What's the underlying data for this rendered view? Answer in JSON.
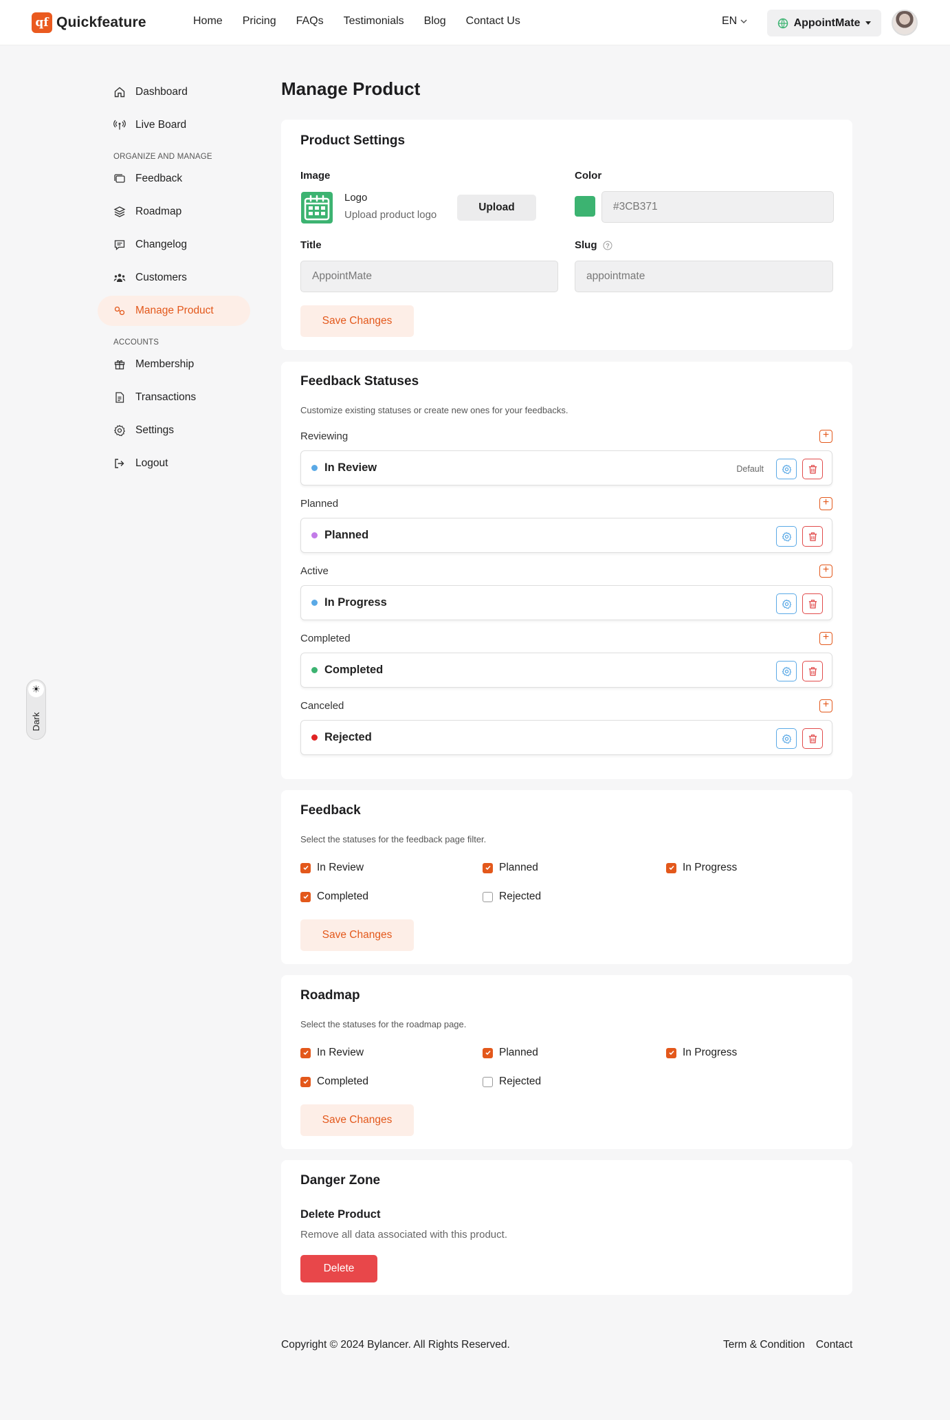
{
  "brand": {
    "mark": "qf",
    "name": "Quickfeature",
    "accent": "#EA5A1F"
  },
  "topnav": {
    "items": [
      "Home",
      "Pricing",
      "FAQs",
      "Testimonials",
      "Blog",
      "Contact Us"
    ]
  },
  "header": {
    "language": "EN",
    "product_switcher": "AppointMate"
  },
  "sidebar": {
    "top_items": [
      {
        "label": "Dashboard",
        "icon": "home-icon"
      },
      {
        "label": "Live Board",
        "icon": "broadcast-icon"
      }
    ],
    "section_org": "ORGANIZE AND MANAGE",
    "org_items": [
      {
        "label": "Feedback",
        "icon": "cards-icon"
      },
      {
        "label": "Roadmap",
        "icon": "layers-icon"
      },
      {
        "label": "Changelog",
        "icon": "message-icon"
      },
      {
        "label": "Customers",
        "icon": "users-icon"
      },
      {
        "label": "Manage Product",
        "icon": "product-icon",
        "active": true
      }
    ],
    "section_accounts": "ACCOUNTS",
    "account_items": [
      {
        "label": "Membership",
        "icon": "gift-icon"
      },
      {
        "label": "Transactions",
        "icon": "document-icon"
      },
      {
        "label": "Settings",
        "icon": "gear-icon"
      },
      {
        "label": "Logout",
        "icon": "logout-icon"
      }
    ]
  },
  "theme_toggle": {
    "label": "Dark"
  },
  "page": {
    "title": "Manage Product"
  },
  "product_settings": {
    "title": "Product Settings",
    "image_label": "Image",
    "logo_name": "Logo",
    "logo_hint": "Upload product logo",
    "upload_label": "Upload",
    "color_label": "Color",
    "color_value": "#3CB371",
    "title_label": "Title",
    "title_value": "AppointMate",
    "slug_label": "Slug",
    "slug_value": "appointmate",
    "save_label": "Save Changes"
  },
  "feedback_statuses": {
    "title": "Feedback Statuses",
    "description": "Customize existing statuses or create new ones for your feedbacks.",
    "default_tag": "Default",
    "groups": [
      {
        "group": "Reviewing",
        "status": "In Review",
        "dot_color": "#5AA9E6",
        "is_default": true
      },
      {
        "group": "Planned",
        "status": "Planned",
        "dot_color": "#C27BE8",
        "is_default": false
      },
      {
        "group": "Active",
        "status": "In Progress",
        "dot_color": "#5AA9E6",
        "is_default": false
      },
      {
        "group": "Completed",
        "status": "Completed",
        "dot_color": "#3CB371",
        "is_default": false
      },
      {
        "group": "Canceled",
        "status": "Rejected",
        "dot_color": "#E02424",
        "is_default": false
      }
    ]
  },
  "feedback_filter": {
    "title": "Feedback",
    "description": "Select the statuses for the feedback page filter.",
    "options": [
      {
        "label": "In Review",
        "checked": true
      },
      {
        "label": "Planned",
        "checked": true
      },
      {
        "label": "In Progress",
        "checked": true
      },
      {
        "label": "Completed",
        "checked": true
      },
      {
        "label": "Rejected",
        "checked": false
      }
    ],
    "save_label": "Save Changes"
  },
  "roadmap_filter": {
    "title": "Roadmap",
    "description": "Select the statuses for the roadmap page.",
    "options": [
      {
        "label": "In Review",
        "checked": true
      },
      {
        "label": "Planned",
        "checked": true
      },
      {
        "label": "In Progress",
        "checked": true
      },
      {
        "label": "Completed",
        "checked": true
      },
      {
        "label": "Rejected",
        "checked": false
      }
    ],
    "save_label": "Save Changes"
  },
  "danger_zone": {
    "title": "Danger Zone",
    "subtitle": "Delete Product",
    "description": "Remove all data associated with this product.",
    "delete_label": "Delete"
  },
  "footer": {
    "copyright": "Copyright © 2024 Bylancer. All Rights Reserved.",
    "links": [
      "Term & Condition",
      "Contact"
    ]
  }
}
